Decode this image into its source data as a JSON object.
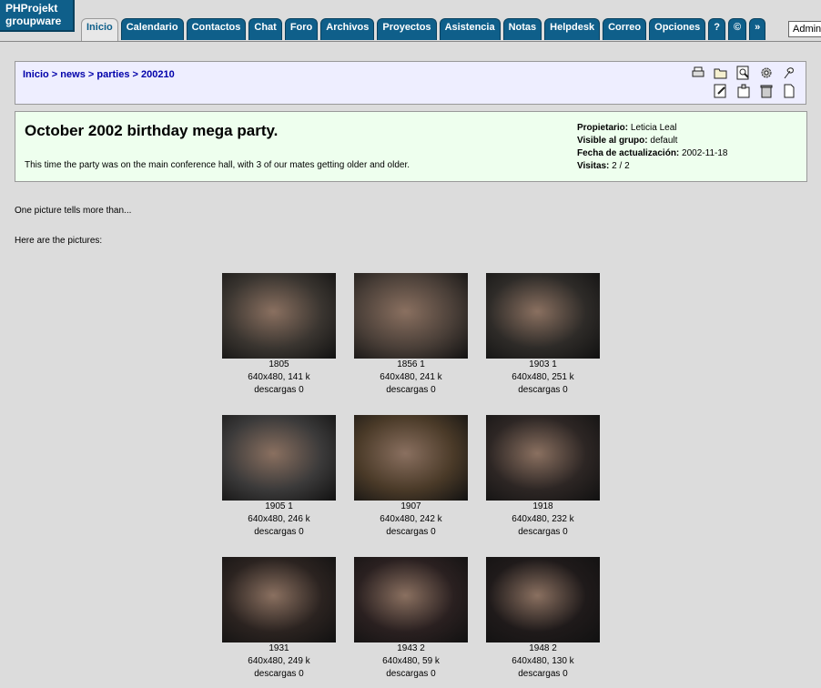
{
  "app": {
    "logo_line1": "PHProjekt",
    "logo_line2": "groupware"
  },
  "nav": {
    "tabs": [
      {
        "label": "Inicio",
        "active": true
      },
      {
        "label": "Calendario"
      },
      {
        "label": "Contactos"
      },
      {
        "label": "Chat"
      },
      {
        "label": "Foro"
      },
      {
        "label": "Archivos"
      },
      {
        "label": "Proyectos"
      },
      {
        "label": "Asistencia"
      },
      {
        "label": "Notas"
      },
      {
        "label": "Helpdesk"
      },
      {
        "label": "Correo"
      },
      {
        "label": "Opciones"
      },
      {
        "label": "?"
      },
      {
        "label": "©"
      },
      {
        "label": "»"
      }
    ],
    "user_value": "Admin"
  },
  "breadcrumb": {
    "items": [
      "Inicio",
      "news",
      "parties",
      "200210"
    ],
    "separator": ">"
  },
  "toolbar": {
    "icons": [
      "print-icon",
      "folder-open-icon",
      "search-icon",
      "settings-gear-icon",
      "flower-icon",
      "edit-icon",
      "stamp-icon",
      "trash-icon",
      "new-page-icon"
    ]
  },
  "article": {
    "title": "October 2002 birthday mega party.",
    "description": "This time the party was on the main conference hall, with 3 of our mates getting older and older.",
    "owner_label": "Propietario:",
    "owner_value": "Leticia Leal",
    "group_label": "Visible al grupo:",
    "group_value": "default",
    "updated_label": "Fecha de actualización:",
    "updated_value": "2002-11-18",
    "visits_label": "Visitas:",
    "visits_value": "2 / 2"
  },
  "body": {
    "para1": "One picture tells more than...",
    "para2": "Here are the pictures:"
  },
  "gallery": {
    "photos": [
      {
        "name": "1805",
        "info": "640x480, 141 k",
        "downloads": "descargas 0",
        "color": "#3a3530"
      },
      {
        "name": "1856 1",
        "info": "640x480, 241 k",
        "downloads": "descargas 0",
        "color": "#4a3f38"
      },
      {
        "name": "1903 1",
        "info": "640x480, 251 k",
        "downloads": "descargas 0",
        "color": "#2e2b28"
      },
      {
        "name": "1905 1",
        "info": "640x480, 246 k",
        "downloads": "descargas 0",
        "color": "#3b3a3a"
      },
      {
        "name": "1907",
        "info": "640x480, 242 k",
        "downloads": "descargas 0",
        "color": "#4a3a28"
      },
      {
        "name": "1918",
        "info": "640x480, 232 k",
        "downloads": "descargas 0",
        "color": "#2d2624"
      },
      {
        "name": "1931",
        "info": "640x480, 249 k",
        "downloads": "descargas 0",
        "color": "#2b2320"
      },
      {
        "name": "1943 2",
        "info": "640x480, 59 k",
        "downloads": "descargas 0",
        "color": "#2a2020"
      },
      {
        "name": "1948 2",
        "info": "640x480, 130 k",
        "downloads": "descargas 0",
        "color": "#1f1a1a"
      }
    ]
  }
}
